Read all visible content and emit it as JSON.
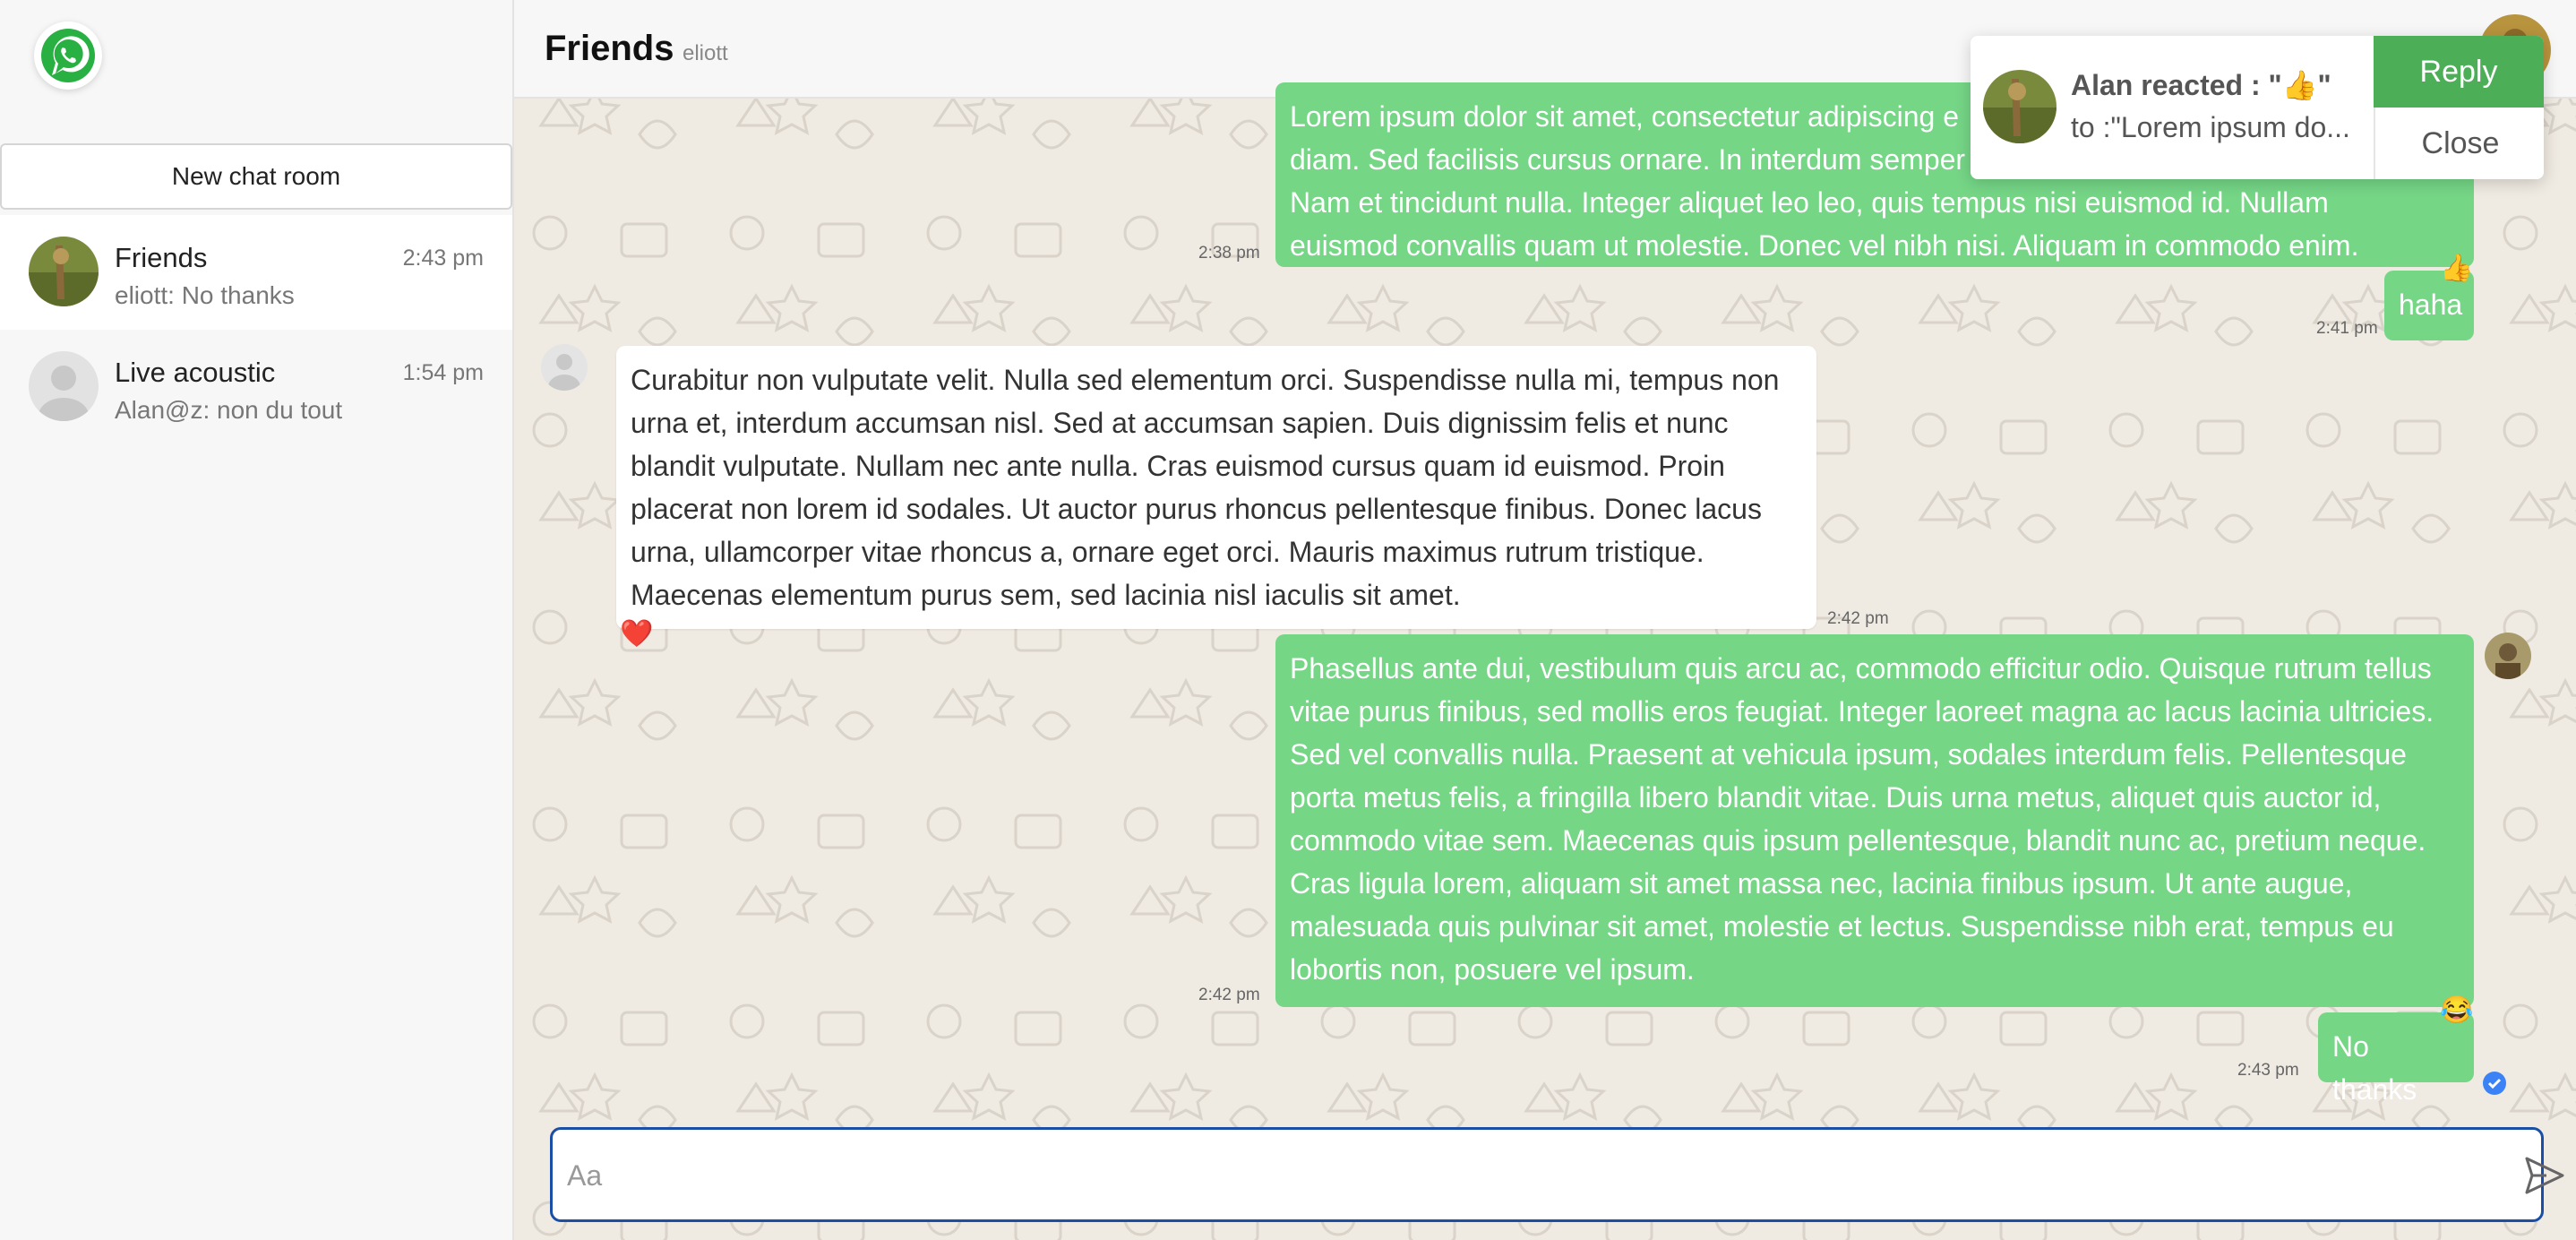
{
  "sidebar": {
    "new_chat_label": "New chat room",
    "conversations": [
      {
        "name": "Friends",
        "time": "2:43 pm",
        "preview": "eliott: No thanks",
        "active": true
      },
      {
        "name": "Live acoustic",
        "time": "1:54 pm",
        "preview": "Alan@z: non du tout",
        "active": false
      }
    ]
  },
  "header": {
    "title": "Friends",
    "subtitle": "eliott"
  },
  "messages": [
    {
      "direction": "out",
      "text": "Lorem ipsum dolor sit amet, consectetur adipiscing e",
      "line2": "diam. Sed facilisis cursus ornare. In interdum semper",
      "line3": "Nam et tincidunt nulla. Integer aliquet leo leo, quis tempus nisi euismod id. Nullam",
      "line4": "euismod convallis quam ut molestie. Donec vel nibh nisi. Aliquam in commodo enim.",
      "time": "2:38 pm"
    },
    {
      "direction": "out",
      "text": "haha",
      "time": "2:41 pm",
      "reaction": "👍"
    },
    {
      "direction": "in",
      "text": "Curabitur non vulputate velit. Nulla sed elementum orci. Suspendisse nulla mi, tempus non urna et, interdum accumsan nisl. Sed at accumsan sapien. Duis dignissim felis et nunc blandit vulputate. Nullam nec ante nulla. Cras euismod cursus quam id euismod. Proin placerat non lorem id sodales. Ut auctor purus rhoncus pellentesque finibus. Donec lacus urna, ullamcorper vitae rhoncus a, ornare eget orci. Mauris maximus rutrum tristique. Maecenas elementum purus sem, sed lacinia nisl iaculis sit amet.",
      "time": "2:42 pm",
      "reaction": "❤️"
    },
    {
      "direction": "out",
      "text": "Phasellus ante dui, vestibulum quis arcu ac, commodo efficitur odio. Quisque rutrum tellus vitae purus finibus, sed mollis eros feugiat. Integer laoreet magna ac lacus lacinia ultricies. Sed vel convallis nulla. Praesent at vehicula ipsum, sodales interdum felis. Pellentesque porta metus felis, a fringilla libero blandit vitae. Duis urna metus, aliquet quis auctor id, commodo vitae sem. Maecenas quis ipsum pellentesque, blandit nunc ac, pretium neque. Cras ligula lorem, aliquam sit amet massa nec, lacinia finibus ipsum. Ut ante augue, malesuada quis pulvinar sit amet, molestie et lectus. Suspendisse nibh erat, tempus eu lobortis non, posuere vel ipsum.",
      "time": "2:42 pm"
    },
    {
      "direction": "out",
      "text": "No thanks",
      "time": "2:43 pm",
      "reaction": "😂"
    }
  ],
  "composer": {
    "placeholder": "Aa"
  },
  "notification": {
    "title": "Alan reacted : \"👍\"",
    "body": "to :\"Lorem ipsum do...",
    "reply_label": "Reply",
    "close_label": "Close"
  },
  "colors": {
    "outgoing": "#75d686",
    "incoming": "#ffffff",
    "accent": "#1b4fa6",
    "reply": "#4caf57"
  }
}
